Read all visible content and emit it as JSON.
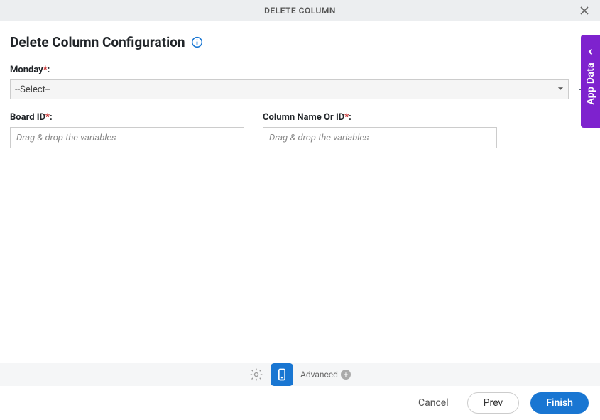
{
  "header": {
    "title": "DELETE COLUMN"
  },
  "page": {
    "title": "Delete Column Configuration"
  },
  "form": {
    "monday": {
      "label": "Monday",
      "selected": "--Select--"
    },
    "board_id": {
      "label": "Board ID",
      "placeholder": "Drag & drop the variables",
      "value": ""
    },
    "column_name": {
      "label": "Column Name Or ID",
      "placeholder": "Drag & drop the variables",
      "value": ""
    }
  },
  "side_panel": {
    "label": "App Data"
  },
  "toolbar": {
    "advanced_label": "Advanced"
  },
  "footer": {
    "cancel": "Cancel",
    "prev": "Prev",
    "finish": "Finish"
  }
}
